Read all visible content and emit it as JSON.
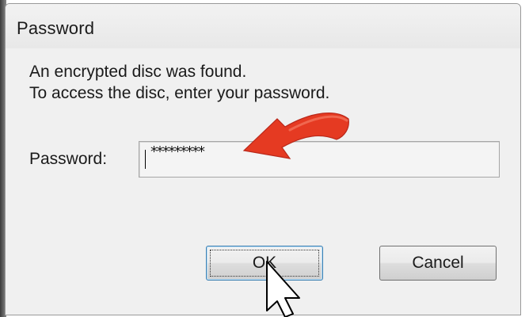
{
  "dialog": {
    "title": "Password",
    "message_line1": "An encrypted disc was found.",
    "message_line2": "To access the disc, enter your password.",
    "password_label": "Password:",
    "password_value": "*********",
    "ok_label": "OK",
    "cancel_label": "Cancel"
  },
  "annotations": {
    "arrow_color": "#e53a22",
    "pointer": "mouse-pointer-icon"
  }
}
